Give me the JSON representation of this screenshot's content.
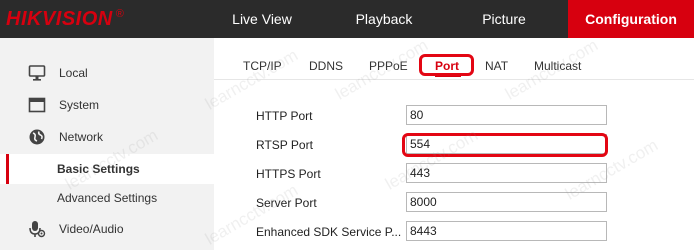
{
  "brand": {
    "logo_text": "HIKVISION",
    "registered_mark": "®",
    "accent_color": "#d7000f"
  },
  "nav": {
    "tabs": [
      {
        "label": "Live View",
        "active": false
      },
      {
        "label": "Playback",
        "active": false
      },
      {
        "label": "Picture",
        "active": false
      },
      {
        "label": "Configuration",
        "active": true
      }
    ]
  },
  "sidebar": {
    "items": [
      {
        "label": "Local",
        "icon": "monitor-icon"
      },
      {
        "label": "System",
        "icon": "window-icon"
      },
      {
        "label": "Network",
        "icon": "globe-icon"
      },
      {
        "label": "Basic Settings",
        "icon": "",
        "active": true
      },
      {
        "label": "Advanced Settings",
        "icon": ""
      },
      {
        "label": "Video/Audio",
        "icon": "microphone-icon"
      }
    ]
  },
  "subtabs": {
    "items": [
      {
        "label": "TCP/IP",
        "active": false
      },
      {
        "label": "DDNS",
        "active": false
      },
      {
        "label": "PPPoE",
        "active": false
      },
      {
        "label": "Port",
        "active": true
      },
      {
        "label": "NAT",
        "active": false
      },
      {
        "label": "Multicast",
        "active": false
      }
    ]
  },
  "form": {
    "fields": [
      {
        "label": "HTTP Port",
        "value": "80"
      },
      {
        "label": "RTSP Port",
        "value": "554",
        "highlighted": true
      },
      {
        "label": "HTTPS Port",
        "value": "443"
      },
      {
        "label": "Server Port",
        "value": "8000"
      },
      {
        "label": "Enhanced SDK Service P...",
        "value": "8443"
      }
    ]
  },
  "watermark": {
    "text": "learncctv.com"
  },
  "colors": {
    "highlight_border": "#e30613",
    "topbar_bg": "#2b2b2b",
    "sidebar_bg": "#f2f2f2"
  }
}
